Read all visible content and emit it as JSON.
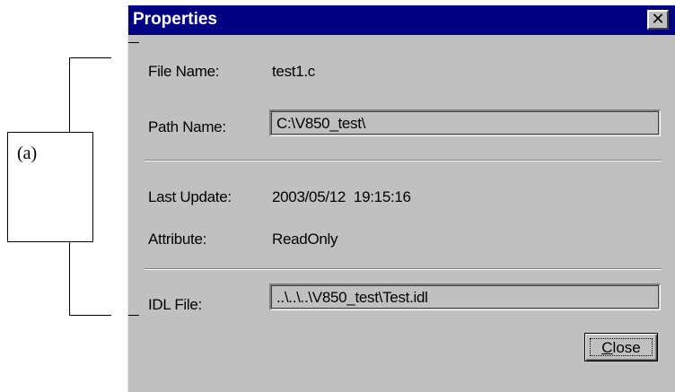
{
  "annotation": {
    "label": "(a)"
  },
  "dialog": {
    "title": "Properties",
    "close_glyph": "✕",
    "file_name": {
      "label": "File Name:",
      "value": "test1.c"
    },
    "path_name": {
      "label": "Path Name:",
      "value": "C:\\V850_test\\"
    },
    "last_update": {
      "label": "Last Update:",
      "value": "2003/05/12  19:15:16"
    },
    "attribute": {
      "label": "Attribute:",
      "value": "ReadOnly"
    },
    "idl_file": {
      "label": "IDL File:",
      "value": "..\\..\\..\\V850_test\\Test.idl"
    },
    "close_button": {
      "mnemonic": "C",
      "rest": "lose"
    }
  },
  "colors": {
    "titlebar": "#000080",
    "face": "#c0c0c0"
  },
  "icons": {
    "title_close": "close-icon"
  }
}
